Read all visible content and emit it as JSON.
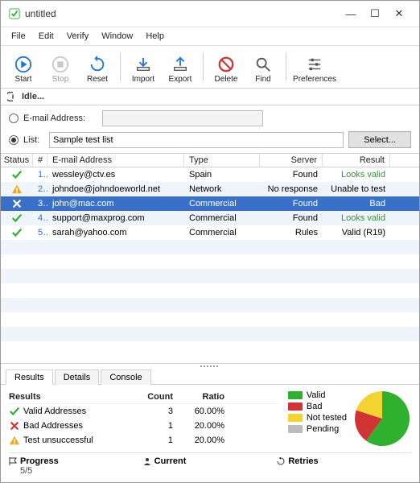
{
  "window": {
    "title": "untitled"
  },
  "menu": [
    "File",
    "Edit",
    "Verify",
    "Window",
    "Help"
  ],
  "toolbar": {
    "start": "Start",
    "stop": "Stop",
    "reset": "Reset",
    "import": "Import",
    "export": "Export",
    "delete": "Delete",
    "find": "Find",
    "preferences": "Preferences"
  },
  "status_text": "Idle...",
  "inputs": {
    "email_label": "E-mail Address:",
    "list_label": "List:",
    "list_value": "Sample test list",
    "select_label": "Select..."
  },
  "columns": {
    "status": "Status",
    "num": "#",
    "email": "E-mail Address",
    "type": "Type",
    "server": "Server",
    "result": "Result"
  },
  "rows": [
    {
      "n": "1",
      "icon": "check",
      "email": "wessley@ctv.es",
      "type": "Spain",
      "server": "Found",
      "result": "Looks valid",
      "rclass": "green-txt"
    },
    {
      "n": "2",
      "icon": "warn",
      "email": "johndoe@johndoeworld.net",
      "type": "Network",
      "server": "No response",
      "result": "Unable to test",
      "rclass": ""
    },
    {
      "n": "3",
      "icon": "bad",
      "email": "john@mac.com",
      "type": "Commercial",
      "server": "Found",
      "result": "Bad",
      "rclass": "red-txt",
      "selected": true
    },
    {
      "n": "4",
      "icon": "check",
      "email": "support@maxprog.com",
      "type": "Commercial",
      "server": "Found",
      "result": "Looks valid",
      "rclass": "green-txt"
    },
    {
      "n": "5",
      "icon": "check",
      "email": "sarah@yahoo.com",
      "type": "Commercial",
      "server": "Rules",
      "result": "Valid (R19)",
      "rclass": ""
    }
  ],
  "tabs": {
    "results": "Results",
    "details": "Details",
    "console": "Console"
  },
  "results_table": {
    "head": {
      "c1": "Results",
      "c2": "Count",
      "c3": "Ratio"
    },
    "rows": [
      {
        "icon": "check",
        "label": "Valid Addresses",
        "count": "3",
        "ratio": "60.00%"
      },
      {
        "icon": "bad",
        "label": "Bad Addresses",
        "count": "1",
        "ratio": "20.00%"
      },
      {
        "icon": "warn",
        "label": "Test unsuccessful",
        "count": "1",
        "ratio": "20.00%"
      }
    ]
  },
  "legend": {
    "valid": "Valid",
    "bad": "Bad",
    "nottested": "Not tested",
    "pending": "Pending"
  },
  "progress": {
    "progress_label": "Progress",
    "progress_value": "5/5",
    "current_label": "Current",
    "retries_label": "Retries"
  },
  "colors": {
    "valid": "#2fb12f",
    "bad": "#d13434",
    "nottested": "#f3d32f",
    "pending": "#bcbcbc",
    "accent": "#1e74e6"
  },
  "chart_data": {
    "type": "pie",
    "title": "",
    "series": [
      {
        "name": "Valid",
        "value": 60,
        "color": "#2fb12f"
      },
      {
        "name": "Bad",
        "value": 20,
        "color": "#d13434"
      },
      {
        "name": "Not tested",
        "value": 20,
        "color": "#f3d32f"
      }
    ]
  }
}
